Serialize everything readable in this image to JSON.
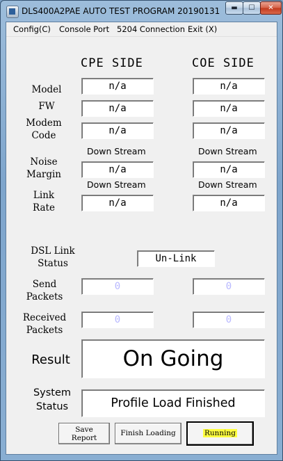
{
  "window": {
    "title": "DLS400A2PAE AUTO TEST PROGRAM 20190131"
  },
  "menu": {
    "items": [
      "Config(C)",
      "Console Port",
      "5204 Connection",
      "Exit (X)"
    ]
  },
  "headers": {
    "cpe": "CPE SIDE",
    "coe": "COE SIDE"
  },
  "labels": {
    "model": "Model",
    "fw": "FW",
    "modem_code_1": "Modem",
    "modem_code_2": "Code",
    "noise_margin_1": "Noise",
    "noise_margin_2": "Margin",
    "link_rate_1": "Link",
    "link_rate_2": "Rate",
    "dsl_link_1": "DSL Link",
    "dsl_link_2": "Status",
    "send_1": "Send",
    "send_2": "Packets",
    "received_1": "Received",
    "received_2": "Packets",
    "result": "Result",
    "system_1": "System",
    "system_2": "Status"
  },
  "cpe": {
    "model": "n/a",
    "fw": "n/a",
    "modem_code": "n/a",
    "noise_margin_caption": "Down Stream",
    "noise_margin": "n/a",
    "link_rate_caption": "Down Stream",
    "link_rate": "n/a",
    "send_packets": "0",
    "received_packets": "0"
  },
  "coe": {
    "model": "n/a",
    "fw": "n/a",
    "modem_code": "n/a",
    "noise_margin_caption": "Down Stream",
    "noise_margin": "n/a",
    "link_rate_caption": "Down Stream",
    "link_rate": "n/a",
    "send_packets": "0",
    "received_packets": "0"
  },
  "dsl_link_status": "Un-Link",
  "result": "On Going",
  "system_status": "Profile Load Finished",
  "buttons": {
    "save_report_1": "Save",
    "save_report_2": "Report",
    "finish_loading": "Finish Loading",
    "running": "Running"
  },
  "colors": {
    "highlight": "#ffff40",
    "zero_value": "#b8b8ff"
  }
}
